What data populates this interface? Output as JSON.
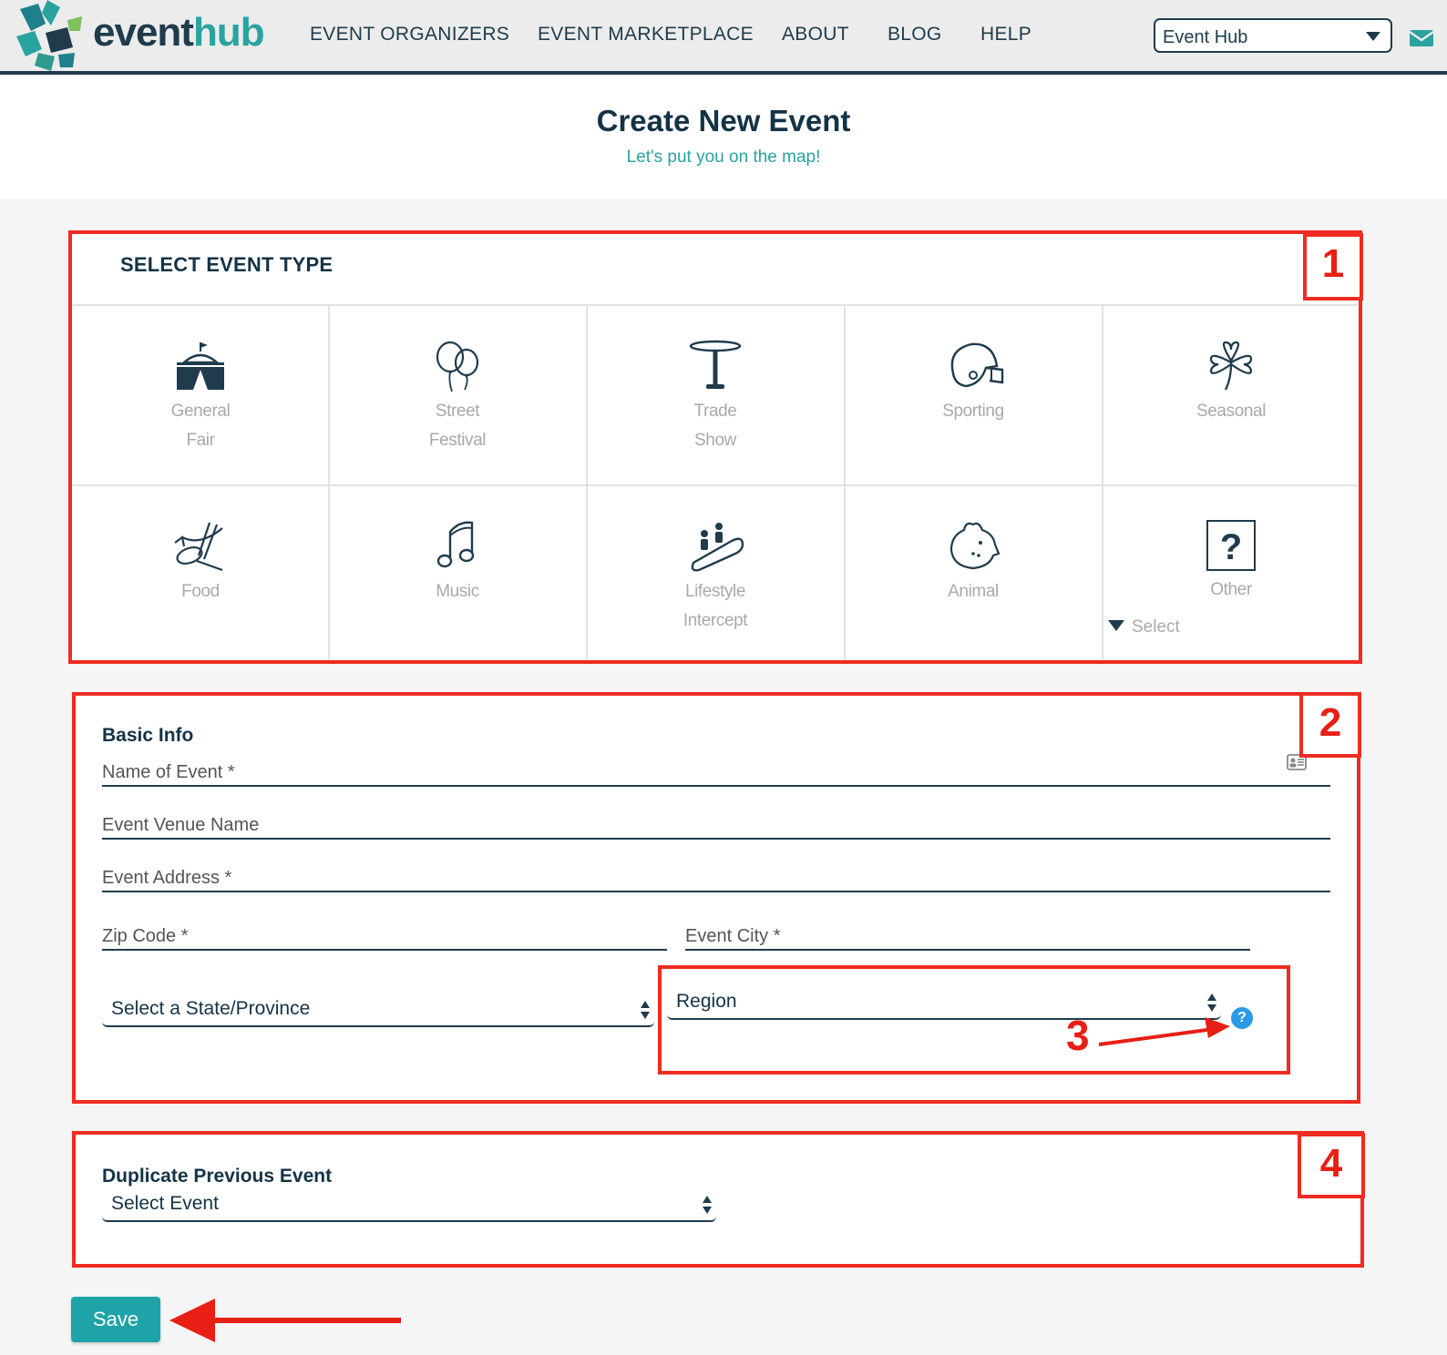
{
  "header": {
    "logo": {
      "part1": "event",
      "part2": "hub"
    },
    "nav": [
      "EVENT ORGANIZERS",
      "EVENT MARKETPLACE",
      "ABOUT",
      "BLOG",
      "HELP"
    ],
    "org_select": "Event Hub"
  },
  "page": {
    "title": "Create New Event",
    "subtitle": "Let's put you on the map!"
  },
  "event_type": {
    "heading": "SELECT EVENT TYPE",
    "types": [
      {
        "line1": "General",
        "line2": "Fair",
        "icon": "tent-icon"
      },
      {
        "line1": "Street",
        "line2": "Festival",
        "icon": "balloons-icon"
      },
      {
        "line1": "Trade",
        "line2": "Show",
        "icon": "table-icon"
      },
      {
        "line1": "Sporting",
        "line2": "",
        "icon": "football-helmet-icon"
      },
      {
        "line1": "Seasonal",
        "line2": "",
        "icon": "shamrock-icon"
      },
      {
        "line1": "Food",
        "line2": "",
        "icon": "food-icon"
      },
      {
        "line1": "Music",
        "line2": "",
        "icon": "music-note-icon"
      },
      {
        "line1": "Lifestyle",
        "line2": "Intercept",
        "icon": "escalator-icon"
      },
      {
        "line1": "Animal",
        "line2": "",
        "icon": "pig-icon"
      },
      {
        "line1": "Other",
        "line2": "",
        "icon": "question-icon"
      }
    ],
    "other_select": "Select"
  },
  "basic_info": {
    "heading": "Basic Info",
    "name_placeholder": "Name of Event *",
    "venue_placeholder": "Event Venue Name",
    "address_placeholder": "Event Address *",
    "zip_placeholder": "Zip Code *",
    "city_placeholder": "Event City *",
    "state_select": "Select a State/Province",
    "region_select": "Region",
    "help_glyph": "?"
  },
  "duplicate": {
    "heading": "Duplicate Previous Event",
    "select": "Select Event"
  },
  "save_label": "Save",
  "annotations": {
    "b1": "1",
    "b2": "2",
    "b3": "3",
    "b4": "4"
  },
  "colors": {
    "accent": "#2aa2a0",
    "navy": "#1f3b4c",
    "annotation_red": "#ef2b22",
    "save": "#1ea3a8"
  }
}
